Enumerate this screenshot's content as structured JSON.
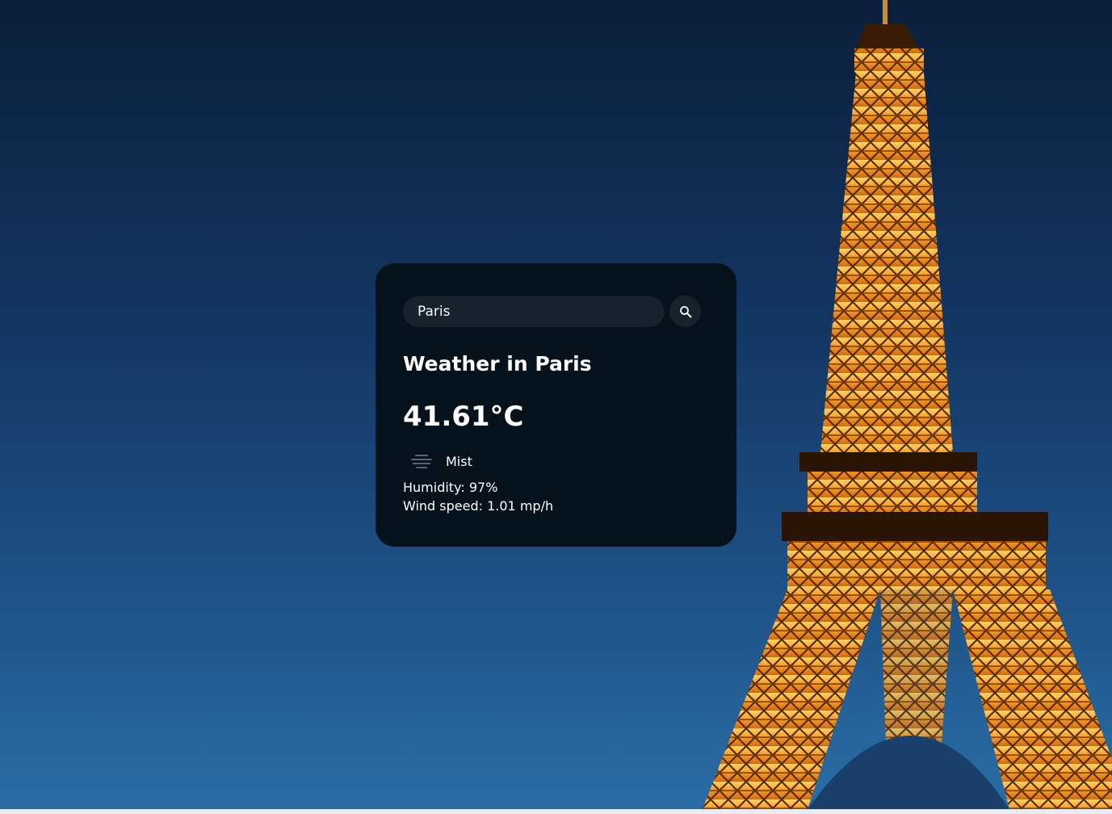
{
  "search": {
    "value": "Paris"
  },
  "weather": {
    "title": "Weather in Paris",
    "temperature": "41.61°C",
    "condition": "Mist",
    "condition_icon": "mist-icon",
    "humidity": "Humidity: 97%",
    "wind_speed": "Wind speed: 1.01 mp/h"
  },
  "icons": {
    "search_button": "search-icon"
  },
  "colors": {
    "card_background": "#05111b",
    "input_background": "#18222c",
    "text": "#ffffff",
    "sky": "#12335e",
    "tower_light": "#f5a12a"
  }
}
